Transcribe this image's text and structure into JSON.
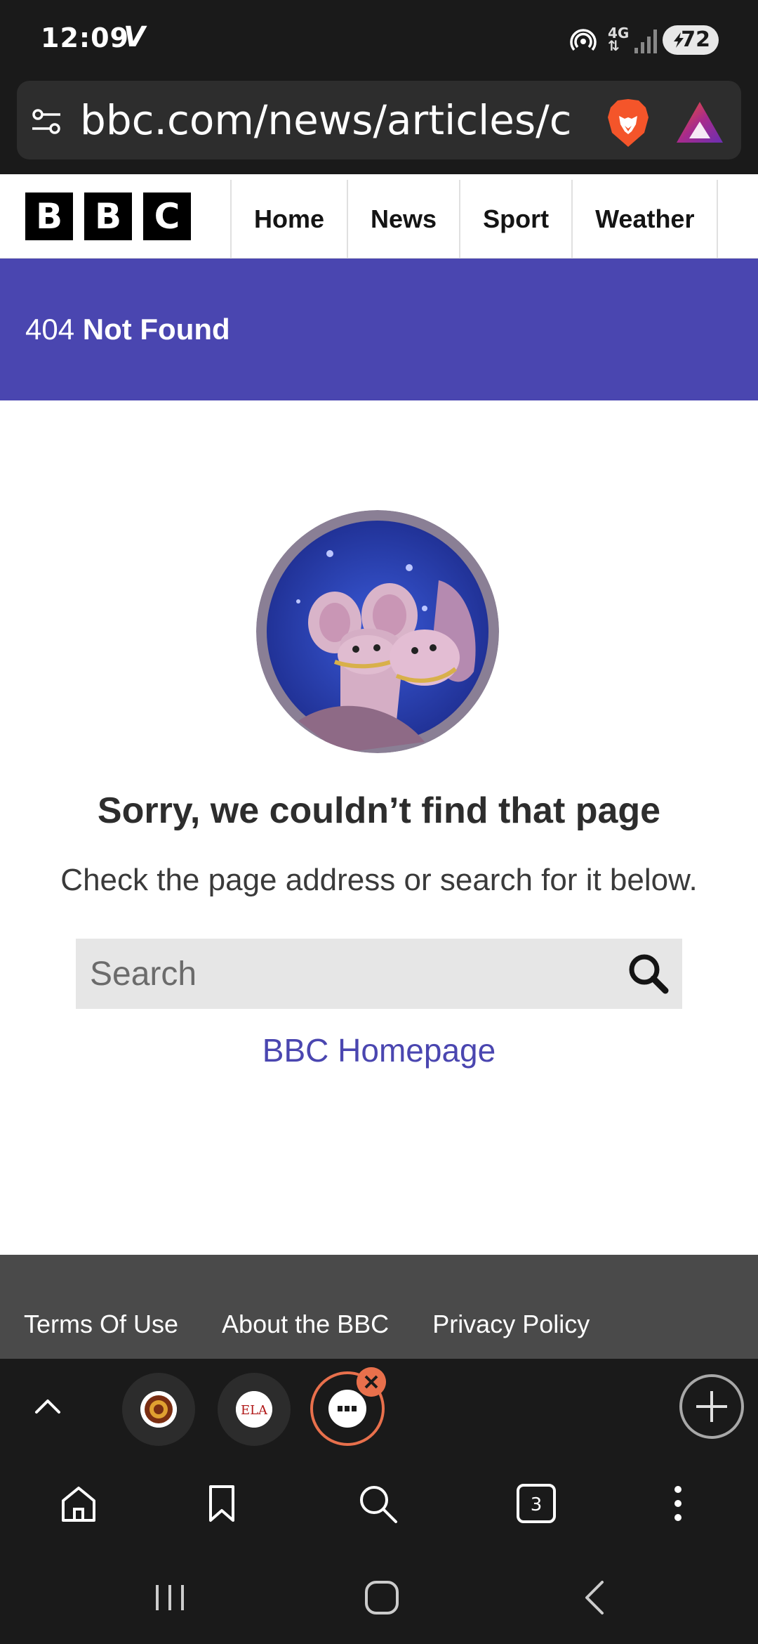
{
  "status_bar": {
    "time": "12:09",
    "carrier_icon": "V",
    "network": "4G",
    "battery": "72"
  },
  "browser": {
    "url": "bbc.com/news/articles/c",
    "tab_count": "3",
    "tabs": [
      {
        "name": "tab-favicon-1"
      },
      {
        "name": "tab-favicon-ela",
        "label": "ELA"
      },
      {
        "name": "tab-active"
      }
    ]
  },
  "header": {
    "logo": [
      "B",
      "B",
      "C"
    ],
    "nav": [
      "Home",
      "News",
      "Sport",
      "Weather"
    ]
  },
  "banner": {
    "code": "404",
    "title": "Not Found"
  },
  "main": {
    "title": "Sorry, we couldn’t find that page",
    "subtitle": "Check the page address or search for it below.",
    "search_placeholder": "Search",
    "home_link": "BBC Homepage"
  },
  "footer": {
    "links": [
      "Terms Of Use",
      "About the BBC",
      "Privacy Policy"
    ]
  },
  "colors": {
    "accent": "#4a46b0",
    "browser_bg": "#1a1a1a",
    "brave_orange": "#e8704c"
  }
}
